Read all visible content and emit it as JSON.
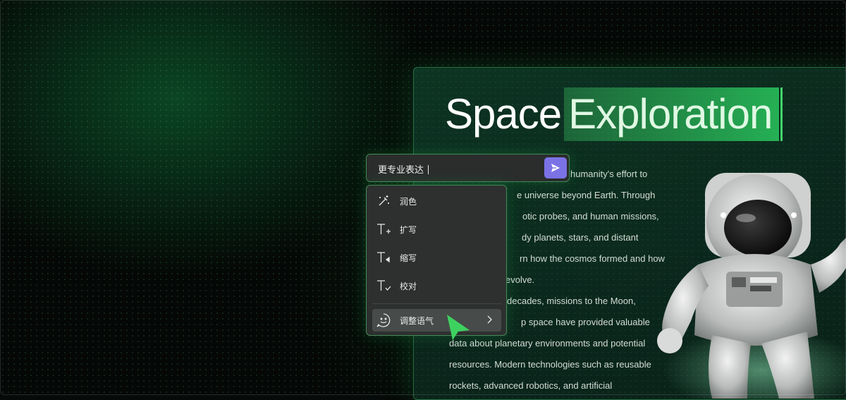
{
  "document": {
    "title_plain": "Space",
    "title_selected": "Exploration",
    "body_lines": [
      "humanity's effort to",
      "e universe beyond Earth. Through",
      "otic probes, and human missions,",
      "dy planets, stars, and distant",
      "rn how the cosmos formed and how",
      "evolve.",
      "decades, missions to the Moon,",
      "p space have provided valuable",
      "data about planetary environments and potential",
      "resources. Modern technologies such as reusable",
      "rockets, advanced robotics, and artificial"
    ]
  },
  "prompt": {
    "value": "更专业表达"
  },
  "menu": {
    "items": [
      {
        "label": "润色",
        "icon": "magic-wand-icon"
      },
      {
        "label": "扩写",
        "icon": "text-expand-icon"
      },
      {
        "label": "缩写",
        "icon": "text-shrink-icon"
      },
      {
        "label": "校对",
        "icon": "text-check-icon"
      },
      {
        "label": "调整语气",
        "icon": "smiley-icon"
      }
    ]
  },
  "colors": {
    "accent_green": "#43d36a",
    "send_button": "#7b72e6",
    "menu_bg": "#2d302f"
  }
}
